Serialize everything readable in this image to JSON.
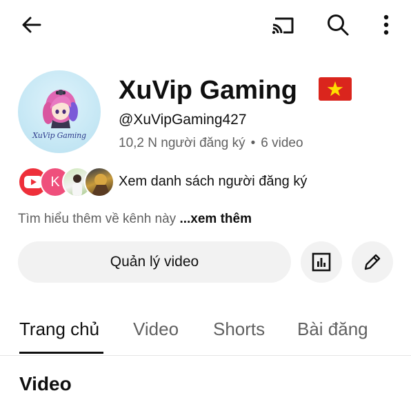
{
  "topbar": {
    "back_icon": "arrow-left-icon",
    "cast_icon": "cast-icon",
    "search_icon": "search-icon",
    "more_icon": "more-vertical-icon"
  },
  "channel": {
    "name": "XuVip Gaming",
    "flag": "vietnam-flag",
    "avatar_text": "XuVip Gaming",
    "handle": "@XuVipGaming427",
    "subscribers": "10,2 N người đăng ký",
    "separator": "•",
    "videos": "6 video"
  },
  "subscribers_row": {
    "avatar_2_letter": "K",
    "label": "Xem danh sách người đăng ký"
  },
  "about": {
    "text": "Tìm hiểu thêm về kênh này ",
    "more": "...xem thêm"
  },
  "actions": {
    "manage_videos": "Quản lý video",
    "stats_icon": "bar-chart-icon",
    "edit_icon": "pencil-icon"
  },
  "tabs": [
    {
      "label": "Trang chủ",
      "active": true
    },
    {
      "label": "Video",
      "active": false
    },
    {
      "label": "Shorts",
      "active": false
    },
    {
      "label": "Bài đăng",
      "active": false
    }
  ],
  "section": {
    "title": "Video"
  },
  "colors": {
    "text_primary": "#0f0f0f",
    "text_secondary": "#606060",
    "button_bg": "#f2f2f2",
    "youtube_red": "#ee2f3a",
    "flag_red": "#da251d",
    "flag_star": "#ffdf00"
  }
}
